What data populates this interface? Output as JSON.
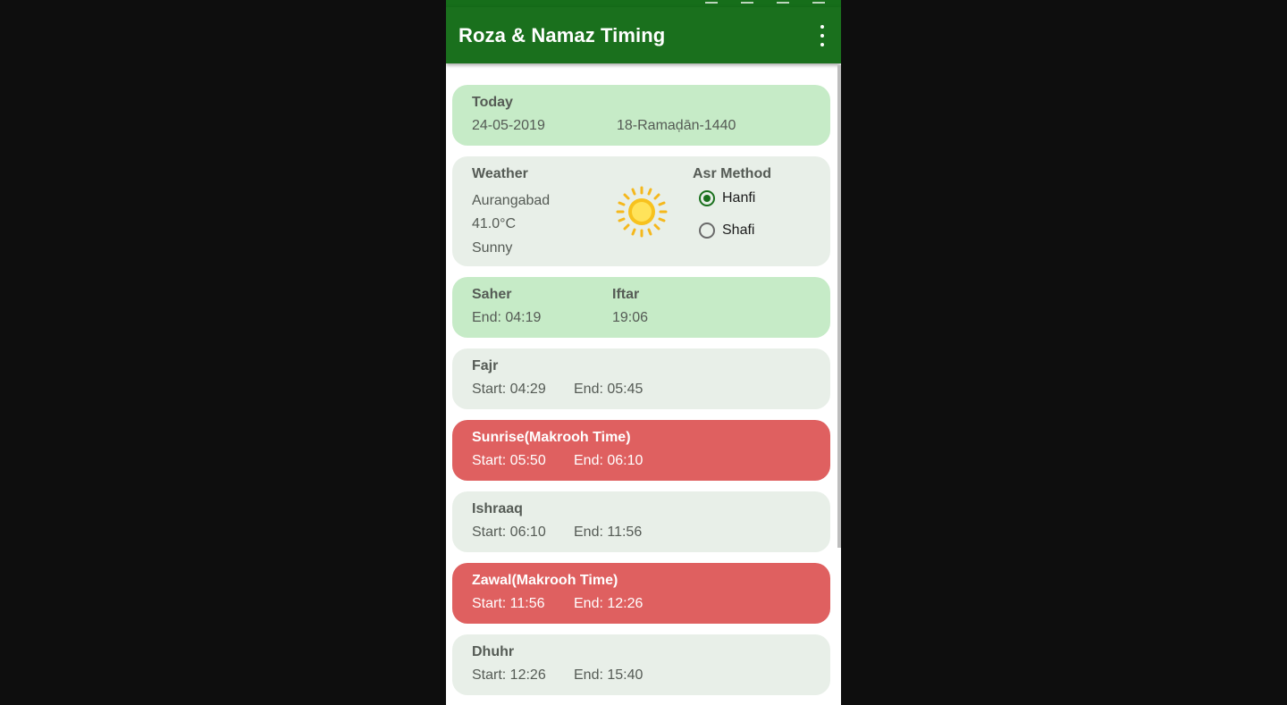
{
  "app": {
    "title": "Roza & Namaz Timing",
    "menu_icon": "more-vert-icon"
  },
  "colors": {
    "appbar": "#1a701d",
    "card_green": "#c6ebc7",
    "card_grey": "#e8efe8",
    "card_red": "#df6060"
  },
  "today": {
    "title": "Today",
    "gregorian": "24-05-2019",
    "hijri": "18-Ramaḍān-1440"
  },
  "weather": {
    "title": "Weather",
    "city": "Aurangabad",
    "temperature": "41.0°C",
    "condition": "Sunny",
    "icon": "sun-icon"
  },
  "asr_method": {
    "title": "Asr Method",
    "options": [
      {
        "label": "Hanfi",
        "selected": true
      },
      {
        "label": "Shafi",
        "selected": false
      }
    ]
  },
  "saher": {
    "title": "Saher",
    "value": "End: 04:19"
  },
  "iftar": {
    "title": "Iftar",
    "value": "19:06"
  },
  "prayers": [
    {
      "name": "Fajr",
      "start": "Start: 04:29",
      "end": "End: 05:45",
      "makrooh": false
    },
    {
      "name": "Sunrise(Makrooh Time)",
      "start": "Start: 05:50",
      "end": "End: 06:10",
      "makrooh": true
    },
    {
      "name": "Ishraaq",
      "start": "Start: 06:10",
      "end": "End: 11:56",
      "makrooh": false
    },
    {
      "name": "Zawal(Makrooh Time)",
      "start": "Start: 11:56",
      "end": "End: 12:26",
      "makrooh": true
    },
    {
      "name": "Dhuhr",
      "start": "Start: 12:26",
      "end": "End: 15:40",
      "makrooh": false
    }
  ]
}
